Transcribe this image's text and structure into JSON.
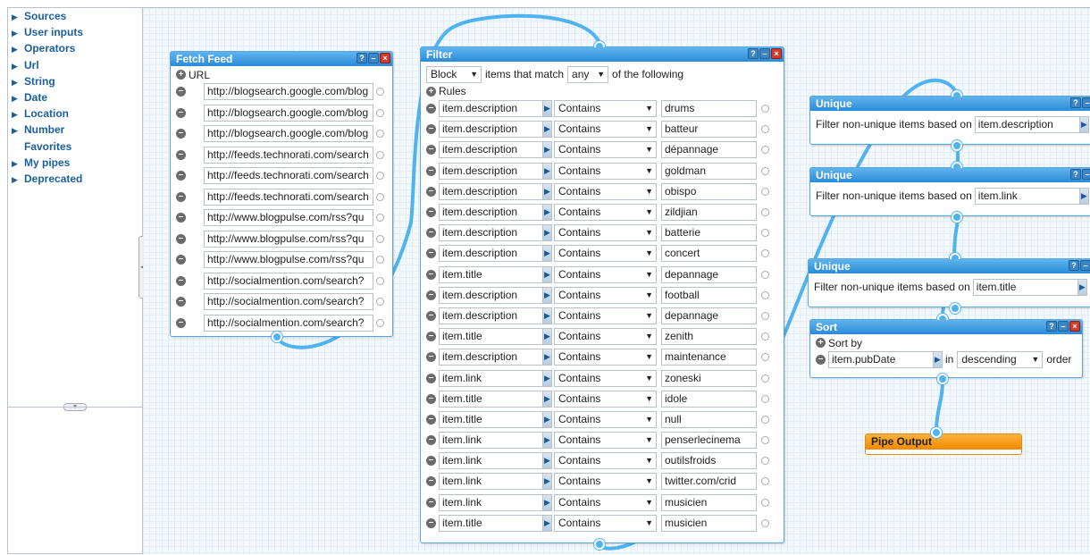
{
  "sidebar": {
    "items": [
      {
        "label": "Sources",
        "arrow": true
      },
      {
        "label": "User inputs",
        "arrow": true
      },
      {
        "label": "Operators",
        "arrow": true
      },
      {
        "label": "Url",
        "arrow": true
      },
      {
        "label": "String",
        "arrow": true
      },
      {
        "label": "Date",
        "arrow": true
      },
      {
        "label": "Location",
        "arrow": true
      },
      {
        "label": "Number",
        "arrow": true
      },
      {
        "label": "Favorites",
        "arrow": false
      },
      {
        "label": "My pipes",
        "arrow": true
      },
      {
        "label": "Deprecated",
        "arrow": true
      }
    ]
  },
  "fetch_feed": {
    "title": "Fetch Feed",
    "url_label": "URL",
    "urls": [
      "http://blogsearch.google.com/blog",
      "http://blogsearch.google.com/blog",
      "http://blogsearch.google.com/blog",
      "http://feeds.technorati.com/search",
      "http://feeds.technorati.com/search",
      "http://feeds.technorati.com/search",
      "http://www.blogpulse.com/rss?qu",
      "http://www.blogpulse.com/rss?qu",
      "http://www.blogpulse.com/rss?qu",
      "http://socialmention.com/search?",
      "http://socialmention.com/search?",
      "http://socialmention.com/search?"
    ]
  },
  "filter": {
    "title": "Filter",
    "mode": "Block",
    "text_items_that_match": "items that match",
    "match": "any",
    "text_of_following": "of the following",
    "rules_label": "Rules",
    "rules": [
      {
        "field": "item.description",
        "op": "Contains",
        "value": "drums"
      },
      {
        "field": "item.description",
        "op": "Contains",
        "value": "batteur"
      },
      {
        "field": "item.description",
        "op": "Contains",
        "value": "dépannage"
      },
      {
        "field": "item.description",
        "op": "Contains",
        "value": "goldman"
      },
      {
        "field": "item.description",
        "op": "Contains",
        "value": "obispo"
      },
      {
        "field": "item.description",
        "op": "Contains",
        "value": "zildjian"
      },
      {
        "field": "item.description",
        "op": "Contains",
        "value": "batterie"
      },
      {
        "field": "item.description",
        "op": "Contains",
        "value": "concert"
      },
      {
        "field": "item.title",
        "op": "Contains",
        "value": "depannage"
      },
      {
        "field": "item.description",
        "op": "Contains",
        "value": "football"
      },
      {
        "field": "item.description",
        "op": "Contains",
        "value": "depannage"
      },
      {
        "field": "item.title",
        "op": "Contains",
        "value": "zenith"
      },
      {
        "field": "item.description",
        "op": "Contains",
        "value": "maintenance"
      },
      {
        "field": "item.link",
        "op": "Contains",
        "value": "zoneski"
      },
      {
        "field": "item.title",
        "op": "Contains",
        "value": "idole"
      },
      {
        "field": "item.title",
        "op": "Contains",
        "value": "null"
      },
      {
        "field": "item.link",
        "op": "Contains",
        "value": "penserlecinema"
      },
      {
        "field": "item.link",
        "op": "Contains",
        "value": "outilsfroids"
      },
      {
        "field": "item.link",
        "op": "Contains",
        "value": "twitter.com/crid"
      },
      {
        "field": "item.link",
        "op": "Contains",
        "value": "musicien"
      },
      {
        "field": "item.title",
        "op": "Contains",
        "value": "musicien"
      }
    ]
  },
  "uniques": [
    {
      "title": "Unique",
      "text": "Filter non-unique items based on",
      "field": "item.description"
    },
    {
      "title": "Unique",
      "text": "Filter non-unique items based on",
      "field": "item.link"
    },
    {
      "title": "Unique",
      "text": "Filter non-unique items based on",
      "field": "item.title"
    }
  ],
  "sort": {
    "title": "Sort",
    "sort_by_label": "Sort by",
    "field": "item.pubDate",
    "in_label": "in",
    "order": "descending",
    "order_label": "order"
  },
  "pipe_output": {
    "title": "Pipe Output"
  },
  "module_buttons": {
    "help": "?",
    "minimize": "–",
    "close": "×"
  },
  "colors": {
    "module_header": "#2b8bd6",
    "wire": "#4fb3f0",
    "output_header": "#f08a00"
  }
}
